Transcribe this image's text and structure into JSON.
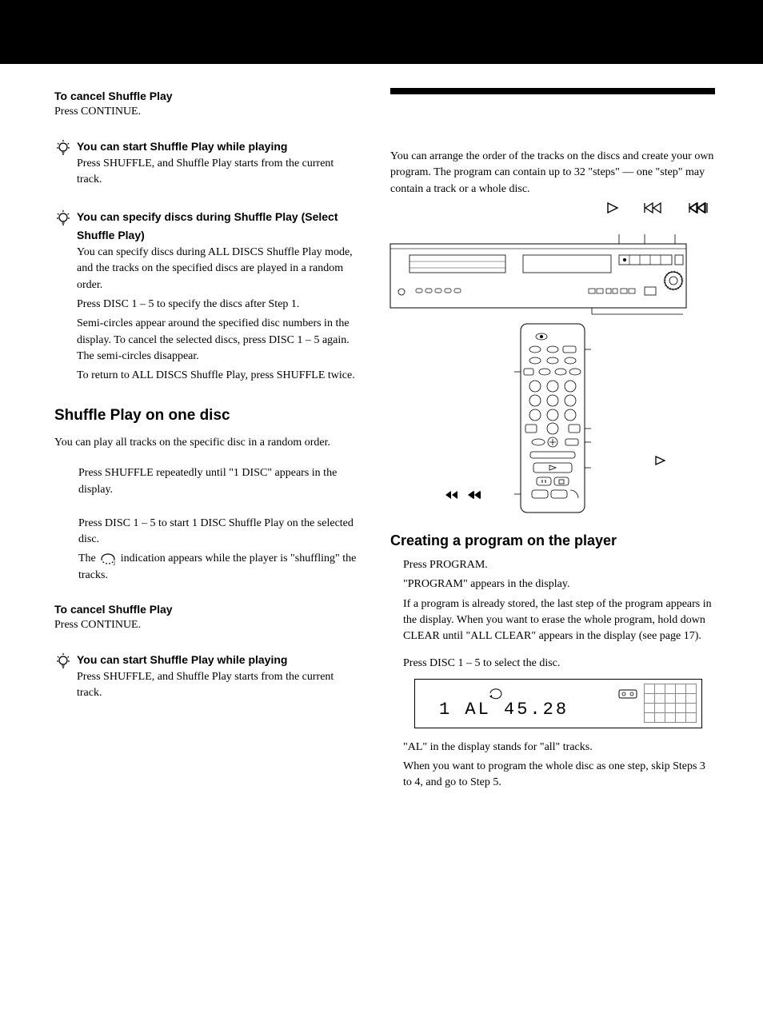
{
  "left": {
    "cancel1": {
      "heading": "To cancel Shuffle Play",
      "body": "Press CONTINUE."
    },
    "tip1": {
      "heading": "You can start Shuffle Play while playing",
      "body": "Press SHUFFLE, and Shuffle Play starts from the current track."
    },
    "tip2": {
      "heading": "You can specify discs during Shuffle Play (Select Shuffle Play)",
      "p1": "You can specify discs during ALL DISCS Shuffle Play mode, and the tracks on the specified discs are played in a random order.",
      "p2": "Press DISC 1 – 5 to specify the discs after Step 1.",
      "p3": "Semi-circles appear around the specified disc numbers in the display. To cancel the selected discs, press DISC 1 – 5 again. The semi-circles disappear.",
      "p4": "To return to ALL DISCS Shuffle Play, press SHUFFLE twice."
    },
    "shuffle_one": {
      "heading": "Shuffle Play on one disc",
      "intro": "You can play all tracks on the specific disc in a random order.",
      "step1": "Press SHUFFLE repeatedly until \"1 DISC\" appears in the display.",
      "step2a": "Press DISC 1 – 5 to start 1 DISC Shuffle Play on the selected disc.",
      "step2b_before": "The ",
      "step2b_after": " indication appears while the player is \"shuffling\" the tracks."
    },
    "cancel2": {
      "heading": "To cancel Shuffle Play",
      "body": "Press CONTINUE."
    },
    "tip3": {
      "heading": "You can start Shuffle Play while playing",
      "body": "Press SHUFFLE, and Shuffle Play starts from the current track."
    }
  },
  "right": {
    "intro": "You can arrange the order of the tracks on the discs and create your own program. The program can contain up to 32 \"steps\" — one \"step\" may contain a track or a whole disc.",
    "creating": {
      "heading": "Creating a program on the player",
      "step1a": "Press PROGRAM.",
      "step1b": "\"PROGRAM\" appears in the display.",
      "step1c": "If a program is already stored, the last step of the program appears in the display. When you want to erase the whole program, hold down CLEAR until \"ALL CLEAR\" appears in the display (see page 17).",
      "step2a": "Press DISC 1 – 5 to select the disc.",
      "display_text": "1  AL  45.28",
      "step2b": "\"AL\" in the display stands for \"all\" tracks.",
      "step2c": "When you want to program the whole disc as one step, skip Steps 3 to 4, and go to Step 5."
    }
  }
}
